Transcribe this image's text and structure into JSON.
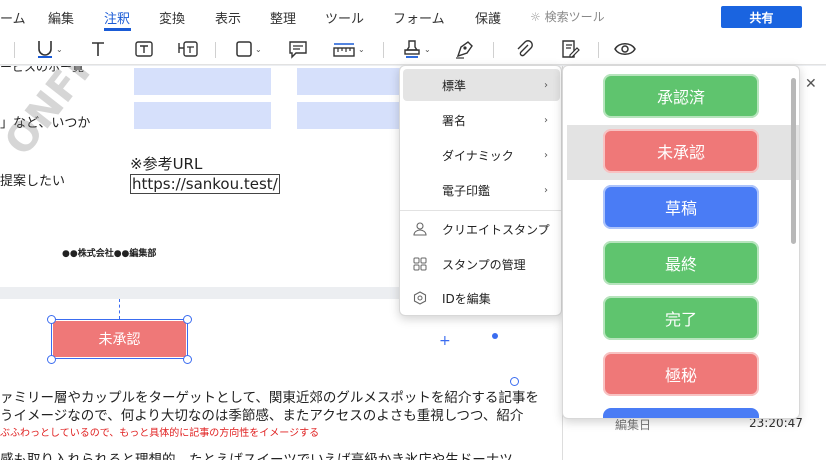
{
  "menubar": {
    "items": [
      "ーム",
      "編集",
      "注釈",
      "変換",
      "表示",
      "整理",
      "ツール",
      "フォーム",
      "保護"
    ],
    "search_label": "検索ツール",
    "share_label": "共有"
  },
  "document": {
    "text_top1": "ービスのホー覧",
    "text_top2": "」など、いつか",
    "text_top3": "提案したい",
    "ref_label": "※参考URL",
    "ref_url": "https://sankou.test/",
    "company": "●●株式会社●●編集部",
    "body_line1": "ァミリー層やカップルをターゲットとして、関東近郊のグルメスポットを紹介する記事を",
    "body_line2": "うイメージなので、何より大切なのは季節感、またアクセスのよさも重視しつつ、紹介",
    "body_note": "ぶふわっとしているので、もっと具体的に記事の方向性をイメージする",
    "body_line3": "感も取り入れられると理想的。たとえばスイーツでいえば高級かき氷店や生ドーナツ",
    "watermark": "ONFI"
  },
  "stamp": {
    "label": "未承認",
    "color": "#ef7878"
  },
  "dropdown": {
    "items": [
      {
        "label": "標準",
        "icon": ""
      },
      {
        "label": "署名",
        "icon": ""
      },
      {
        "label": "ダイナミック",
        "icon": ""
      },
      {
        "label": "電子印鑑",
        "icon": ""
      },
      {
        "label": "クリエイトスタンプ",
        "icon": "person-stamp-icon"
      },
      {
        "label": "スタンプの管理",
        "icon": "grid-icon"
      },
      {
        "label": "IDを編集",
        "icon": "id-hex-icon"
      }
    ]
  },
  "stamp_panel": {
    "stamps": [
      {
        "label": "承認済",
        "color": "#5fc46e"
      },
      {
        "label": "未承認",
        "color": "#ef7878"
      },
      {
        "label": "草稿",
        "color": "#4a7cf5"
      },
      {
        "label": "最終",
        "color": "#5fc46e"
      },
      {
        "label": "完了",
        "color": "#5fc46e"
      },
      {
        "label": "極秘",
        "color": "#ef7878"
      }
    ]
  },
  "right_panel": {
    "edit_date_label": "編集日",
    "edit_time": "23:20:47"
  }
}
